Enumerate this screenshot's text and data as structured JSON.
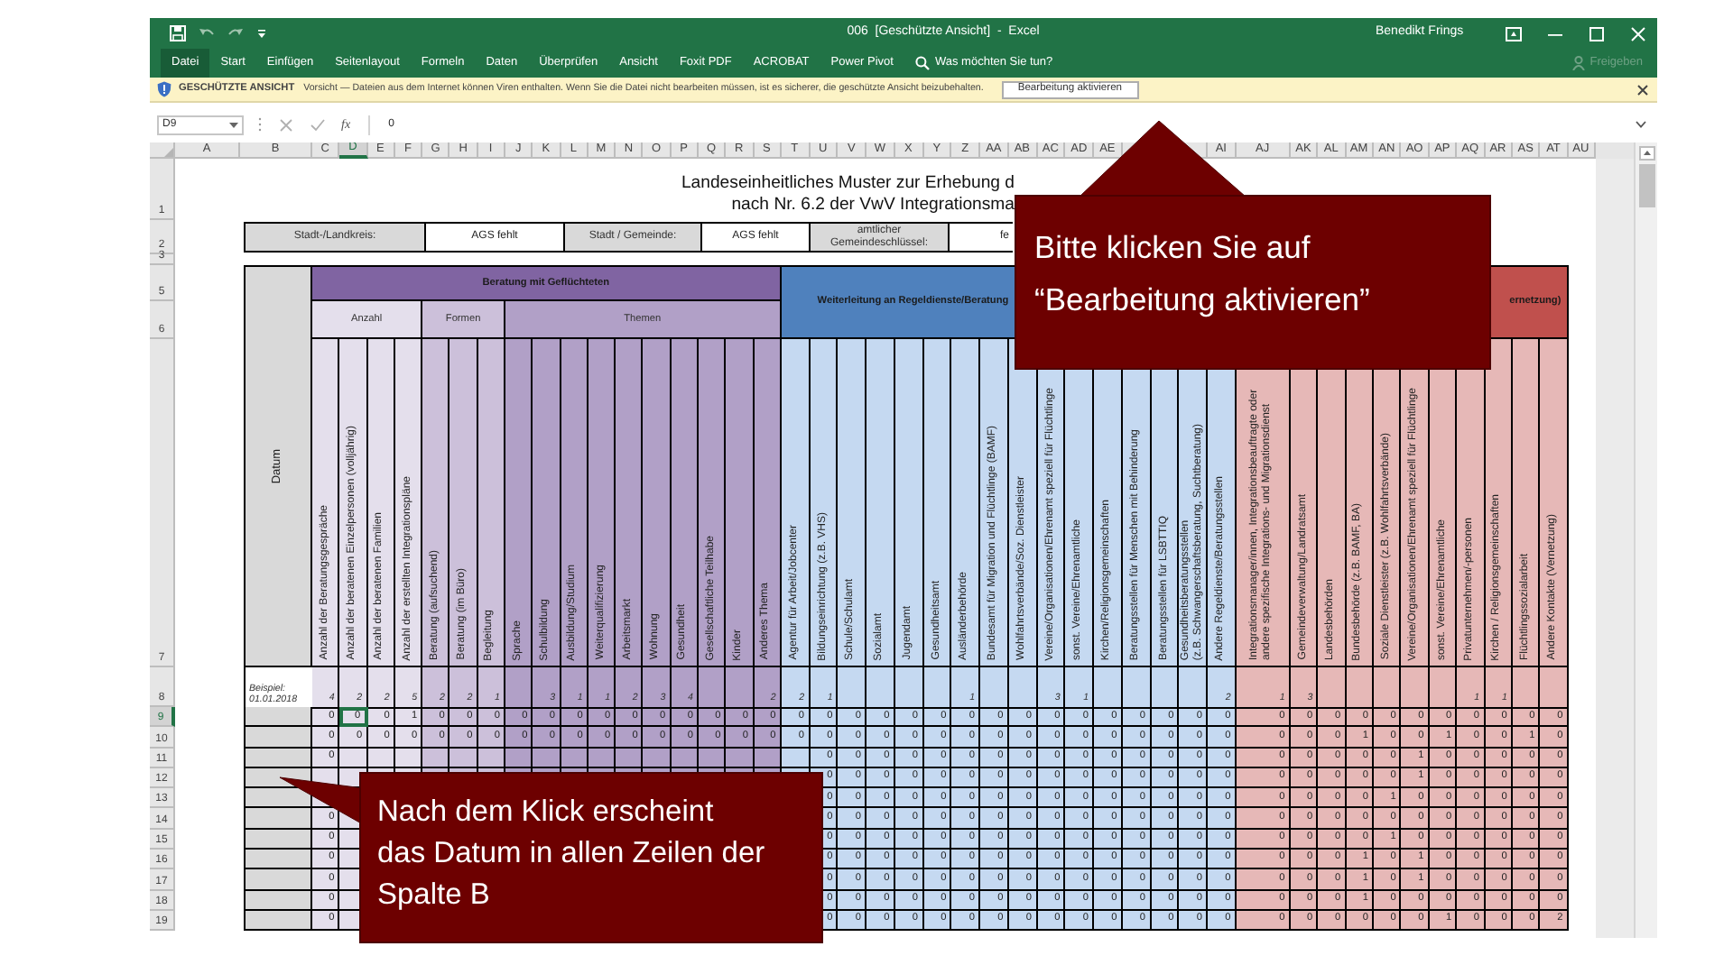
{
  "window": {
    "title": "006  [Geschützte Ansicht]  -  Excel",
    "user": "Benedikt Frings"
  },
  "ribbon": {
    "tabs": [
      {
        "label": "Datei",
        "kind": "file"
      },
      {
        "label": "Start",
        "kind": "tab"
      },
      {
        "label": "Einfügen",
        "kind": "tab"
      },
      {
        "label": "Seitenlayout",
        "kind": "tab"
      },
      {
        "label": "Formeln",
        "kind": "tab"
      },
      {
        "label": "Daten",
        "kind": "tab"
      },
      {
        "label": "Überprüfen",
        "kind": "tab"
      },
      {
        "label": "Ansicht",
        "kind": "tab"
      },
      {
        "label": "Foxit PDF",
        "kind": "tab"
      },
      {
        "label": "ACROBAT",
        "kind": "tab"
      },
      {
        "label": "Power Pivot",
        "kind": "tab"
      }
    ],
    "tell_me": "Was möchten Sie tun?",
    "share": {
      "label": "Freigeben",
      "disabled": true
    }
  },
  "protected_view": {
    "title": "GESCHÜTZTE ANSICHT",
    "message": "Vorsicht — Dateien aus dem Internet können Viren enthalten. Wenn Sie die Datei nicht bearbeiten müssen, ist es sicherer, die geschützte Ansicht beizubehalten.",
    "button": "Bearbeitung aktivieren"
  },
  "formula_bar": {
    "name_box": "D9",
    "function_label": "fx",
    "value": "0"
  },
  "sheet": {
    "column_headers": [
      {
        "letter": "A",
        "selected": false
      },
      {
        "letter": "B",
        "selected": false
      },
      {
        "letter": "C",
        "selected": false
      },
      {
        "letter": "D",
        "selected": true
      },
      {
        "letter": "E",
        "selected": false
      },
      {
        "letter": "F",
        "selected": false
      },
      {
        "letter": "G",
        "selected": false
      },
      {
        "letter": "H",
        "selected": false
      },
      {
        "letter": "I",
        "selected": false
      },
      {
        "letter": "J",
        "selected": false
      },
      {
        "letter": "K",
        "selected": false
      },
      {
        "letter": "L",
        "selected": false
      },
      {
        "letter": "M",
        "selected": false
      },
      {
        "letter": "N",
        "selected": false
      },
      {
        "letter": "O",
        "selected": false
      },
      {
        "letter": "P",
        "selected": false
      },
      {
        "letter": "Q",
        "selected": false
      },
      {
        "letter": "R",
        "selected": false
      },
      {
        "letter": "S",
        "selected": false
      },
      {
        "letter": "T",
        "selected": false
      },
      {
        "letter": "U",
        "selected": false
      },
      {
        "letter": "V",
        "selected": false
      },
      {
        "letter": "W",
        "selected": false
      },
      {
        "letter": "X",
        "selected": false
      },
      {
        "letter": "Y",
        "selected": false
      },
      {
        "letter": "Z",
        "selected": false
      },
      {
        "letter": "AA",
        "selected": false
      },
      {
        "letter": "AB",
        "selected": false
      },
      {
        "letter": "AC",
        "selected": false
      },
      {
        "letter": "AD",
        "selected": false
      },
      {
        "letter": "AE",
        "selected": false
      },
      {
        "selected": false
      },
      {
        "selected": false
      },
      {
        "letter": "AI",
        "selected": false
      },
      {
        "letter": "AJ",
        "selected": false
      },
      {
        "letter": "AK",
        "selected": false
      },
      {
        "letter": "AL",
        "selected": false
      },
      {
        "letter": "AM",
        "selected": false
      },
      {
        "letter": "AN",
        "selected": false
      },
      {
        "letter": "AO",
        "selected": false
      },
      {
        "letter": "AP",
        "selected": false
      },
      {
        "letter": "AQ",
        "selected": false
      },
      {
        "letter": "AR",
        "selected": false
      },
      {
        "letter": "AS",
        "selected": false
      },
      {
        "letter": "AT",
        "selected": false
      },
      {
        "letter": "AU",
        "selected": false
      }
    ],
    "header_row_numbers": [
      "1",
      "2",
      "3",
      "5",
      "6",
      "7"
    ],
    "title_lines": [
      "Landeseinheitliches Muster zur Erhebung d",
      "nach Nr. 6.2 der VwV Integrationsma"
    ],
    "info_row": [
      {
        "kind": "label",
        "text": "Stadt-/Landkreis:"
      },
      {
        "kind": "value",
        "text": "AGS fehlt"
      },
      {
        "kind": "label",
        "text": "Stadt / Gemeinde:"
      },
      {
        "kind": "value",
        "text": "AGS fehlt"
      },
      {
        "kind": "label",
        "text": "amtlicher\nGemeindeschlüssel:"
      },
      {
        "kind": "value",
        "text": "fe"
      }
    ],
    "date_header": "Datum",
    "groups": [
      {
        "title": "Beratung mit Geflüchteten",
        "color": "#8064a2",
        "subgroups": [
          {
            "title": "Anzahl",
            "color": "#e4dfec",
            "columns": [
              "Anzahl der Beratungsgespräche",
              "Anzahl der beratenen Einzelpersonen (volljährig)",
              "Anzahl der beratenen Familien",
              "Anzahl der erstellten Integrationspläne"
            ]
          },
          {
            "title": "Formen",
            "color": "#ccc0da",
            "columns": [
              "Beratung (aufsuchend)",
              "Beratung (im Büro)",
              "Begleitung"
            ]
          },
          {
            "title": "Themen",
            "color": "#b1a0c7",
            "columns": [
              "Sprache",
              "Schulbildung",
              "Ausbildung/Studium",
              "Weiterqualifizierung",
              "Arbeitsmarkt",
              "Wohnung",
              "Gesundheit",
              "Gesellschaftliche Teilhabe",
              "Kinder",
              "Anderes Thema"
            ]
          }
        ]
      },
      {
        "title": "Weiterleitung an Regeldienste/Beratung",
        "color": "#4f81bd",
        "subgroups": [
          {
            "color": "#c5d9f1",
            "columns": [
              "Agentur für Arbeit/Jobcenter",
              "Bildungseinrichtung (z.B. VHS)",
              "Schule/Schulamt",
              "Sozialamt",
              "Jugendamt",
              "Gesundheitsamt",
              "Ausländerbehörde",
              "Bundesamt für Migration und Flüchtlinge (BAMF)",
              "Wohlfahrtsverbände/Soz. Dienstleister",
              "Vereine/Organisationen/Ehrenamt speziell für Flüchtlinge",
              "sonst. Vereine/Ehrenamtliche",
              "Kirchen/Religionsgemeinschaften",
              "Beratungsstellen für Menschen mit Behinderung",
              "Beratungsstellen für LSBTTIQ",
              "Gesundheitsberatungsstellen\n(z.B. Schwangerschaftsberatung, Suchtberatung)",
              "Andere Regeldienste/Beratungsstellen"
            ]
          }
        ]
      },
      {
        "title": "ernetzung)",
        "color": "#c0504d",
        "subgroups": [
          {
            "color": "#e6b8b7",
            "columns": [
              "Integrationsmanager/innen, Integrationsbeauftragte oder andere spezifische Integrations- und Migrationsdienst",
              "Gemeindeverwaltung/Landratsamt",
              "Landesbehörden",
              "Bundesbehörde (z.B. BAMF, BA)",
              "Soziale Dienstleister (z.B. Wohlfahrtsverbände)",
              "Vereine/Organisationen/Ehrenamt speziell für Flüchtlinge",
              "sonst. Vereine/Ehrenamtliche",
              "Privatunternehmen/-personen",
              "Kirchen / Religionsgemeinschaften",
              "Flüchtlingssozialarbeit",
              "Andere Kontakte (Vernetzung)"
            ]
          }
        ]
      }
    ],
    "example_row": {
      "number": "8",
      "selected": false,
      "label": "Beispiel:",
      "date": "01.01.2018",
      "cells": [
        "4",
        "2",
        "2",
        "5",
        "2",
        "2",
        "1",
        null,
        "3",
        "1",
        "1",
        "2",
        "3",
        "4",
        null,
        null,
        "2",
        "2",
        "1",
        null,
        null,
        null,
        null,
        "1",
        null,
        null,
        "3",
        "1",
        null,
        null,
        null,
        null,
        "2",
        "1",
        "3",
        null,
        null,
        null,
        null,
        null,
        "1",
        "1",
        null,
        null
      ]
    },
    "data_rows": [
      {
        "number": "9",
        "selected": true,
        "cells": [
          "0",
          "0",
          "0",
          "1",
          "0",
          "0",
          "0",
          "0",
          "0",
          "0",
          "0",
          "0",
          "0",
          "0",
          "0",
          "0",
          "0",
          "0",
          "0",
          "0",
          "0",
          "0",
          "0",
          "0",
          "0",
          "0",
          "0",
          "0",
          "0",
          "0",
          "0",
          "0",
          "0",
          "0",
          "0",
          "0",
          "0",
          "0",
          "0",
          "0",
          "0",
          "0",
          "0",
          "0"
        ]
      },
      {
        "number": "10",
        "selected": false,
        "cells": [
          "0",
          "0",
          "0",
          "0",
          "0",
          "0",
          "0",
          "0",
          "0",
          "0",
          "0",
          "0",
          "0",
          "0",
          "0",
          "0",
          "0",
          "0",
          "0",
          "0",
          "0",
          "0",
          "0",
          "0",
          "0",
          "0",
          "0",
          "0",
          "0",
          "0",
          "0",
          "0",
          "0",
          "0",
          "0",
          "0",
          "1",
          "0",
          "0",
          "1",
          "0",
          "0",
          "1",
          "0"
        ]
      },
      {
        "number": "11",
        "selected": false,
        "cells": [
          "0",
          null,
          null,
          null,
          null,
          null,
          null,
          null,
          null,
          null,
          null,
          null,
          null,
          null,
          null,
          null,
          null,
          null,
          "0",
          "0",
          "0",
          "0",
          "0",
          "0",
          "0",
          "0",
          "0",
          "0",
          "0",
          "0",
          "0",
          "0",
          "0",
          "0",
          "0",
          "0",
          "0",
          "0",
          "1",
          "0",
          "0",
          "0",
          "0",
          "0"
        ]
      },
      {
        "number": "12",
        "selected": false,
        "cells": [
          null,
          null,
          null,
          null,
          null,
          null,
          null,
          null,
          null,
          null,
          null,
          null,
          null,
          null,
          null,
          null,
          null,
          null,
          "0",
          "0",
          "0",
          "0",
          "0",
          "0",
          "0",
          "0",
          "0",
          "0",
          "0",
          "0",
          "0",
          "0",
          "0",
          "0",
          "0",
          "0",
          "0",
          "0",
          "1",
          "0",
          "0",
          "0",
          "0",
          "0"
        ]
      },
      {
        "number": "13",
        "selected": false,
        "cells": [
          null,
          null,
          null,
          null,
          null,
          null,
          null,
          null,
          null,
          null,
          null,
          null,
          null,
          null,
          null,
          null,
          null,
          null,
          "0",
          "0",
          "0",
          "0",
          "0",
          "0",
          "0",
          "0",
          "0",
          "0",
          "0",
          "0",
          "0",
          "0",
          "0",
          "0",
          "0",
          "0",
          "0",
          "1",
          "0",
          "0",
          "0",
          "0",
          "0",
          "0"
        ]
      },
      {
        "number": "14",
        "selected": false,
        "cells": [
          "0",
          null,
          null,
          null,
          null,
          null,
          null,
          null,
          null,
          null,
          null,
          null,
          null,
          null,
          null,
          null,
          null,
          null,
          "0",
          "0",
          "0",
          "0",
          "0",
          "0",
          "0",
          "0",
          "0",
          "0",
          "0",
          "0",
          "0",
          "0",
          "0",
          "0",
          "0",
          "0",
          "0",
          "0",
          "0",
          "0",
          "0",
          "0",
          "0",
          "0"
        ]
      },
      {
        "number": "15",
        "selected": false,
        "cells": [
          "0",
          null,
          null,
          null,
          null,
          null,
          null,
          null,
          null,
          null,
          null,
          null,
          null,
          null,
          null,
          null,
          null,
          null,
          "0",
          "0",
          "0",
          "0",
          "0",
          "0",
          "0",
          "0",
          "0",
          "0",
          "0",
          "0",
          "0",
          "0",
          "0",
          "0",
          "0",
          "0",
          "0",
          "1",
          "0",
          "0",
          "0",
          "0",
          "0",
          "0"
        ]
      },
      {
        "number": "16",
        "selected": false,
        "cells": [
          "0",
          null,
          null,
          null,
          null,
          null,
          null,
          null,
          null,
          null,
          null,
          null,
          null,
          null,
          null,
          null,
          null,
          null,
          "0",
          "0",
          "0",
          "0",
          "0",
          "0",
          "0",
          "0",
          "0",
          "0",
          "0",
          "0",
          "0",
          "0",
          "0",
          "0",
          "0",
          "0",
          "1",
          "0",
          "1",
          "0",
          "0",
          "0",
          "0",
          "0"
        ]
      },
      {
        "number": "17",
        "selected": false,
        "cells": [
          "0",
          null,
          null,
          null,
          null,
          null,
          null,
          null,
          null,
          null,
          null,
          null,
          null,
          null,
          null,
          null,
          null,
          null,
          "0",
          "0",
          "0",
          "0",
          "0",
          "0",
          "0",
          "0",
          "0",
          "0",
          "0",
          "0",
          "0",
          "0",
          "0",
          "0",
          "0",
          "0",
          "1",
          "0",
          "1",
          "0",
          "0",
          "0",
          "0",
          "0"
        ]
      },
      {
        "number": "18",
        "selected": false,
        "cells": [
          "0",
          null,
          null,
          null,
          null,
          null,
          null,
          null,
          null,
          null,
          null,
          null,
          null,
          null,
          null,
          null,
          null,
          null,
          "0",
          "0",
          "0",
          "0",
          "0",
          "0",
          "0",
          "0",
          "0",
          "0",
          "0",
          "0",
          "0",
          "0",
          "0",
          "0",
          "0",
          "0",
          "1",
          "0",
          "0",
          "0",
          "0",
          "0",
          "0",
          "0"
        ]
      },
      {
        "number": "19",
        "selected": false,
        "cells": [
          "0",
          null,
          null,
          null,
          null,
          null,
          null,
          null,
          null,
          null,
          null,
          null,
          null,
          null,
          null,
          null,
          null,
          null,
          "0",
          "0",
          "0",
          "0",
          "0",
          "0",
          "0",
          "0",
          "0",
          "0",
          "0",
          "0",
          "0",
          "0",
          "0",
          "0",
          "0",
          "0",
          "0",
          "0",
          "0",
          "1",
          "0",
          "0",
          "0",
          "2"
        ]
      }
    ]
  },
  "callouts": [
    {
      "text": "Bitte klicken Sie auf\n“Bearbeitung aktivieren”"
    },
    {
      "text": "Nach dem Klick erscheint\ndas Datum in allen Zeilen der\nSpalte B"
    }
  ]
}
